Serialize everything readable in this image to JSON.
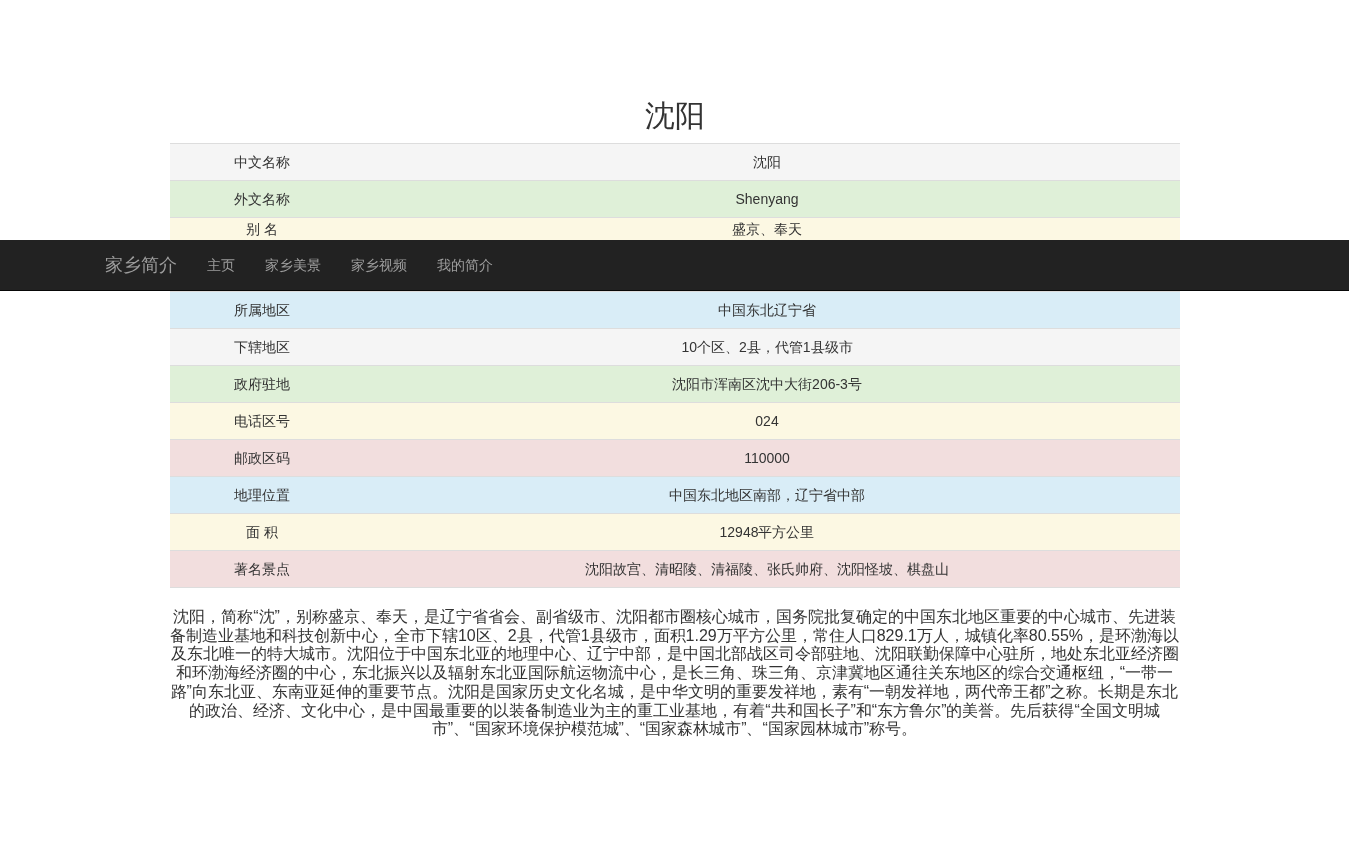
{
  "title": "沈阳",
  "table": {
    "top_rows": [
      {
        "label": "中文名称",
        "value": "沈阳",
        "color": "#f5f5f5"
      },
      {
        "label": "外文名称",
        "value": "Shenyang",
        "color": "#dff0d8"
      },
      {
        "label": "别 名",
        "value": "盛京、奉天",
        "color": "#fcf8e3"
      }
    ],
    "bottom_rows": [
      {
        "label": "所属地区",
        "value": "中国东北辽宁省",
        "color": "#d9edf7"
      },
      {
        "label": "下辖地区",
        "value": "10个区、2县，代管1县级市",
        "color": "#f5f5f5"
      },
      {
        "label": "政府驻地",
        "value": "沈阳市浑南区沈中大街206-3号",
        "color": "#dff0d8"
      },
      {
        "label": "电话区号",
        "value": "024",
        "color": "#fcf8e3"
      },
      {
        "label": "邮政区码",
        "value": "110000",
        "color": "#f2dede"
      },
      {
        "label": "地理位置",
        "value": "中国东北地区南部，辽宁省中部",
        "color": "#d9edf7"
      },
      {
        "label": "面 积",
        "value": "12948平方公里",
        "color": "#fcf8e3"
      },
      {
        "label": "著名景点",
        "value": "沈阳故宫、清昭陵、清福陵、张氏帅府、沈阳怪坡、棋盘山",
        "color": "#f2dede"
      }
    ]
  },
  "navbar": {
    "brand": "家乡简介",
    "links": [
      "主页",
      "家乡美景",
      "家乡视频",
      "我的简介"
    ]
  },
  "description": "沈阳，简称“沈”，别称盛京、奉天，是辽宁省省会、副省级市、沈阳都市圈核心城市，国务院批复确定的中国东北地区重要的中心城市、先进装备制造业基地和科技创新中心，全市下辖10区、2县，代管1县级市，面积1.29万平方公里，常住人口829.1万人，城镇化率80.55%，是环渤海以及东北唯一的特大城市。沈阳位于中国东北亚的地理中心、辽宁中部，是中国北部战区司令部驻地、沈阳联勤保障中心驻所，地处东北亚经济圈和环渤海经济圈的中心，东北振兴以及辐射东北亚国际航运物流中心，是长三角、珠三角、京津冀地区通往关东地区的综合交通枢纽，“一带一路”向东北亚、东南亚延伸的重要节点。沈阳是国家历史文化名城，是中华文明的重要发祥地，素有“一朝发祥地，两代帝王都”之称。长期是东北的政治、经济、文化中心，是中国最重要的以装备制造业为主的重工业基地，有着“共和国长子”和“东方鲁尔”的美誉。先后获得“全国文明城市”、“国家环境保护模范城”、“国家森林城市”、“国家园林城市”称号。"
}
